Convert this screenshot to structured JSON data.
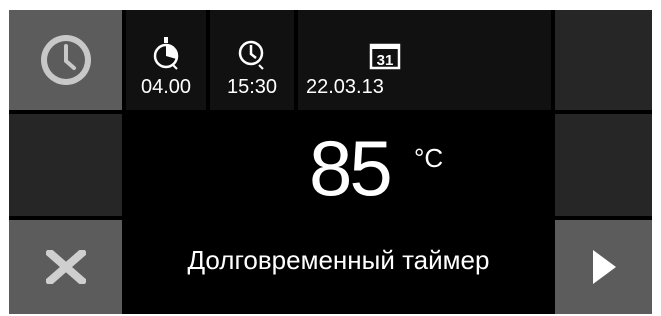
{
  "window": {
    "bg_color": "#000000",
    "button_color": "#5c5c5c"
  },
  "left": {
    "clock_button_icon": "clock-icon",
    "close_button_icon": "x-icon"
  },
  "right": {
    "next_button_icon": "play-right-icon"
  },
  "timer": {
    "icon": "stopwatch-icon",
    "value": "04.00"
  },
  "clock": {
    "icon": "clock-icon",
    "value": "15:30"
  },
  "date": {
    "icon": "calendar-icon",
    "day": "31",
    "value": "22.03.13"
  },
  "main": {
    "temperature": "85",
    "unit": "°C",
    "mode": "Долговременный таймер"
  }
}
